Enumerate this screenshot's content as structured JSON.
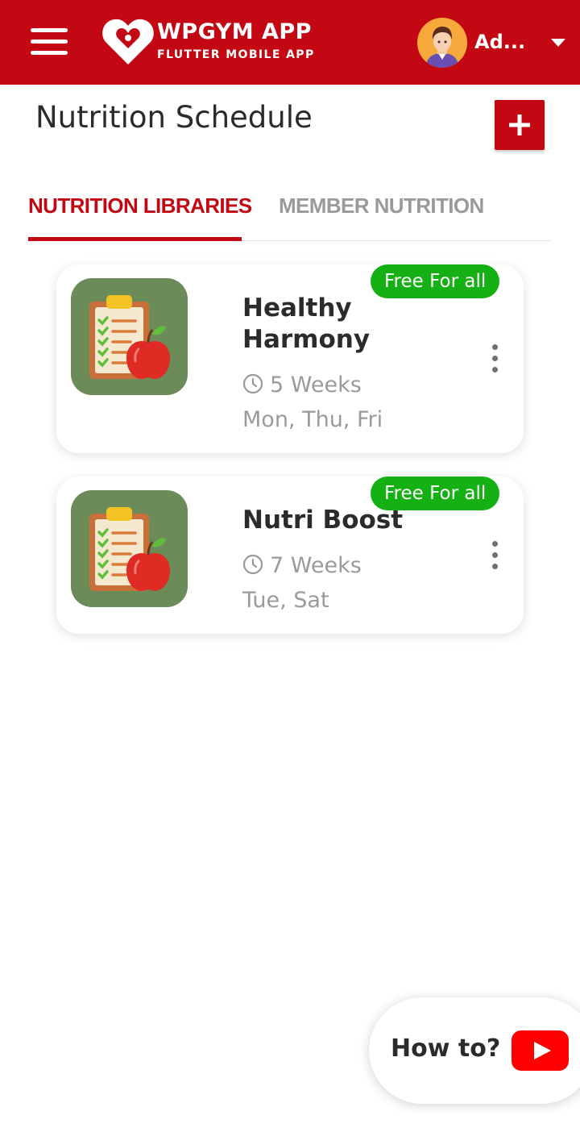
{
  "header": {
    "brand_title": "WPGYM APP",
    "brand_subtitle": "FLUTTER MOBILE APP",
    "user_name": "Ad..."
  },
  "page": {
    "title": "Nutrition Schedule"
  },
  "tabs": [
    {
      "label": "NUTRITION LIBRARIES",
      "active": true
    },
    {
      "label": "MEMBER NUTRITION",
      "active": false
    }
  ],
  "nutrition_items": [
    {
      "badge": "Free For all",
      "name": "Healthy Harmony",
      "duration": "5 Weeks",
      "days": "Mon, Thu, Fri"
    },
    {
      "badge": "Free For all",
      "name": "Nutri Boost",
      "duration": "7 Weeks",
      "days": "Tue, Sat"
    }
  ],
  "help": {
    "label": "How to?"
  },
  "colors": {
    "brand_red": "#c30813",
    "badge_green": "#14b014",
    "image_bg": "#6b8b58",
    "muted_text": "#9a9a9a"
  },
  "icons": [
    "menu-icon",
    "wpgym-logo",
    "user-avatar",
    "chevron-down-icon",
    "plus-icon",
    "nutrition-clipboard-apple-icon",
    "clock-icon",
    "more-vertical-icon",
    "youtube-icon"
  ]
}
